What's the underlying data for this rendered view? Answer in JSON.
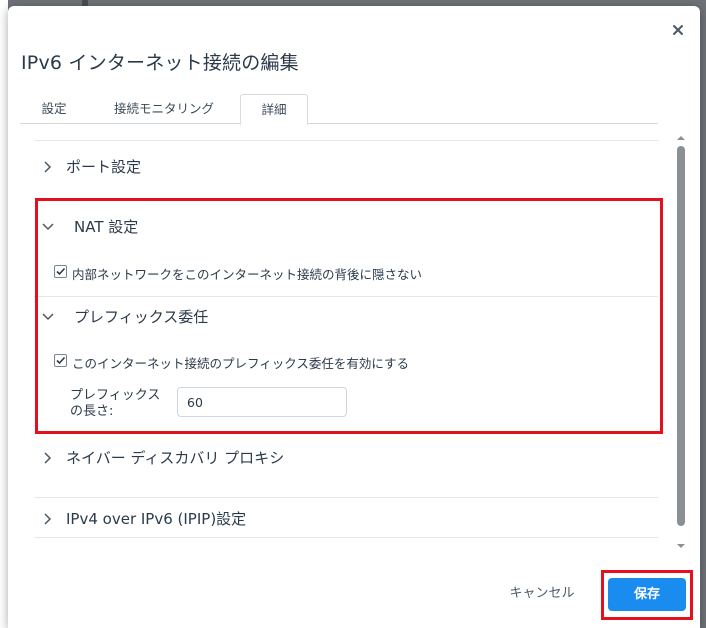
{
  "dialog": {
    "title": "IPv6 インターネット接続の編集",
    "close_icon": "close-icon"
  },
  "tabs": [
    {
      "label": "設定",
      "active": false
    },
    {
      "label": "接続モニタリング",
      "active": false
    },
    {
      "label": "詳細",
      "active": true
    }
  ],
  "sections": {
    "port": {
      "label": "ポート設定",
      "expanded": false
    },
    "nat": {
      "label": "NAT 設定",
      "expanded": true,
      "checkbox_label": "内部ネットワークをこのインターネット接続の背後に隠さない",
      "checked": true
    },
    "prefix": {
      "label": "プレフィックス委任",
      "expanded": true,
      "checkbox_label": "このインターネット接続のプレフィックス委任を有効にする",
      "checked": true,
      "length_label_line1": "プレフィックス",
      "length_label_line2": "の長さ:",
      "length_value": "60"
    },
    "neighbor": {
      "label": "ネイバー ディスカバリ プロキシ",
      "expanded": false
    },
    "ipip": {
      "label": "IPv4 over IPv6 (IPIP)設定",
      "expanded": false
    }
  },
  "footer": {
    "cancel_label": "キャンセル",
    "save_label": "保存"
  },
  "colors": {
    "accent": "#1a8cf0",
    "highlight": "#e3101e",
    "text": "#2b3a4a"
  }
}
